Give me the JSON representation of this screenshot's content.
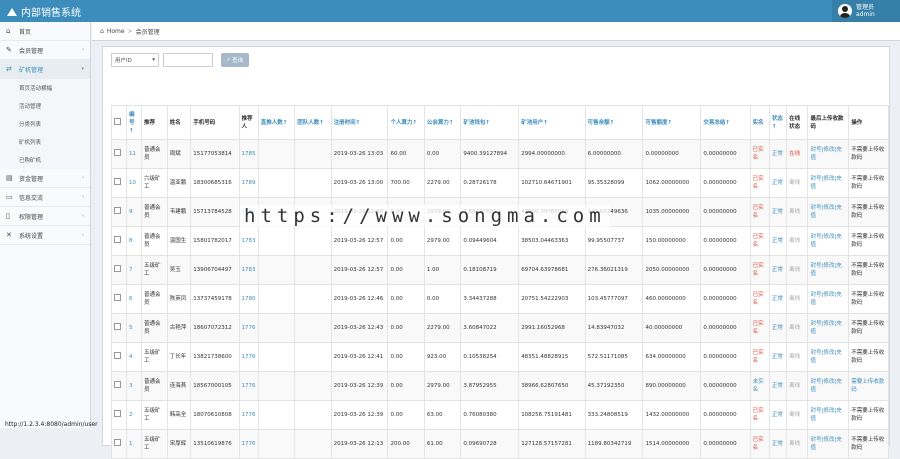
{
  "app": {
    "title": "内部销售系统",
    "user_role": "管理员",
    "user_name": "admin"
  },
  "sidebar": {
    "items": [
      {
        "label": "首页",
        "icon": "dashboard-icon",
        "glyph": "⌂"
      },
      {
        "label": "会员管理",
        "icon": "edit-icon",
        "glyph": "✎"
      },
      {
        "label": "矿机管理",
        "icon": "shuffle-icon",
        "glyph": "⇄",
        "active": true
      }
    ],
    "subitems": [
      "首页活动横幅",
      "活动管理",
      "分类列表",
      "矿机列表",
      "已购矿机"
    ],
    "items2": [
      {
        "label": "资金管理",
        "icon": "money-icon",
        "glyph": "▤"
      },
      {
        "label": "信息交流",
        "icon": "chat-icon",
        "glyph": "▭"
      },
      {
        "label": "权限管理",
        "icon": "file-icon",
        "glyph": "▯"
      },
      {
        "label": "系统设置",
        "icon": "settings-icon",
        "glyph": "✕"
      }
    ]
  },
  "breadcrumb": {
    "home": "Home",
    "sep": ">",
    "current": "会员管理"
  },
  "filter": {
    "select": "用户ID",
    "button": "查询"
  },
  "table": {
    "headers": [
      "编号↑",
      "推荐",
      "姓名",
      "手机号码",
      "推荐人",
      "直推人数↑",
      "团队人数↑",
      "注册时间↑",
      "个人算力↑",
      "公会算力↑",
      "矿池钱包↑",
      "矿池用户↑",
      "可售余额↑",
      "可售额度↑",
      "交易冻结↑",
      "实名",
      "状态↑",
      "在线状态",
      "最后上传收款码",
      "操作"
    ],
    "rows": [
      [
        "11",
        "普通会员",
        "周斌",
        "15177053814",
        "1785",
        "",
        "",
        "2019-03-26 13:03",
        "60.00",
        "0.00",
        "9400.39127894",
        "2994.00000000",
        "6.00000000",
        "0.00000000",
        "0.00000000",
        "已实名",
        "正常",
        "在线",
        "封号|修改|充值",
        "不需要上传收款码"
      ],
      [
        "10",
        "六级矿工",
        "温亚鹏",
        "18300685316",
        "1789",
        "",
        "",
        "2019-03-26 13:00",
        "700.00",
        "2279.00",
        "0.28726178",
        "102710.64671901",
        "95.35328099",
        "1062.00000000",
        "0.00000000",
        "已实名",
        "正常",
        "离线",
        "封号|修改|充值",
        "不需要上传收款码"
      ],
      [
        "9",
        "普通会员",
        "韦建鹏",
        "15713784528",
        "1788",
        "",
        "",
        "2019-03-26 12:58",
        "0.00",
        "2979.00",
        "7.88417681",
        "47600.39765064",
        "121.60249636",
        "1035.00000000",
        "0.00000000",
        "已实名",
        "正常",
        "离线",
        "封号|修改|充值",
        "不需要上传收款码"
      ],
      [
        "8",
        "普通会员",
        "温国生",
        "15801782017",
        "1783",
        "",
        "",
        "2019-03-26 12:57",
        "0.00",
        "2979.00",
        "0.09449604",
        "38503.04463363",
        "99.95507737",
        "150.00000000",
        "0.00000000",
        "已实名",
        "正常",
        "离线",
        "封号|修改|充值",
        "不需要上传收款码"
      ],
      [
        "7",
        "五级矿工",
        "吴玉",
        "13906704497",
        "1783",
        "",
        "",
        "2019-03-26 12:57",
        "0.00",
        "1.00",
        "0.18108719",
        "69704.63978681",
        "276.36021319",
        "2050.00000000",
        "0.00000000",
        "已实名",
        "正常",
        "离线",
        "封号|修改|充值",
        "不需要上传收款码"
      ],
      [
        "6",
        "普通会员",
        "陈英凤",
        "13737459178",
        "1780",
        "",
        "",
        "2019-03-26 12:46",
        "0.00",
        "0.00",
        "3.34437288",
        "20751.54222903",
        "103.45777097",
        "460.00000000",
        "0.00000000",
        "已实名",
        "正常",
        "离线",
        "封号|修改|充值",
        "不需要上传收款码"
      ],
      [
        "5",
        "普通会员",
        "古艳萍",
        "18607072312",
        "1776",
        "",
        "",
        "2019-03-26 12:43",
        "0.00",
        "2279.00",
        "3.60847022",
        "2991.16052968",
        "14.83947032",
        "40.00000000",
        "0.00000000",
        "已实名",
        "正常",
        "离线",
        "封号|修改|充值",
        "不需要上传收款码"
      ],
      [
        "4",
        "五级矿工",
        "丁长年",
        "13821738600",
        "1776",
        "",
        "",
        "2019-03-26 12:41",
        "0.00",
        "923.00",
        "0.10538254",
        "48351.48828915",
        "572.51171085",
        "634.00000000",
        "0.00000000",
        "已实名",
        "正常",
        "离线",
        "封号|修改|充值",
        "不需要上传收款码"
      ],
      [
        "3",
        "普通会员",
        "连海燕",
        "18567000105",
        "1776",
        "",
        "",
        "2019-03-26 12:39",
        "0.00",
        "2979.00",
        "3.87952955",
        "38966.62807650",
        "45.37192350",
        "890.00000000",
        "0.00000000",
        "未实名",
        "正常",
        "离线",
        "封号|修改|充值",
        "需要上传收款码"
      ],
      [
        "2",
        "五级矿工",
        "韩高全",
        "18070610808",
        "1776",
        "",
        "",
        "2019-03-26 12:39",
        "0.00",
        "63.00",
        "0.76080380",
        "108256.75191481",
        "333.24808519",
        "1432.00000000",
        "0.00000000",
        "已实名",
        "正常",
        "离线",
        "封号|修改|充值",
        "不需要上传收款码"
      ],
      [
        "1",
        "五级矿工",
        "宋厚辉",
        "13510619876",
        "1776",
        "",
        "",
        "2019-03-26 12:13",
        "200.00",
        "61.00",
        "0.09690728",
        "127128.57157281",
        "1189.80342719",
        "1514.00000000",
        "0.00000000",
        "已实名",
        "正常",
        "离线",
        "封号|修改|充值",
        "不需要上传收款码"
      ]
    ]
  },
  "watermark": "https://www.songma.com",
  "bottom_text": "http://1.2.3.4:8080/admin/user"
}
